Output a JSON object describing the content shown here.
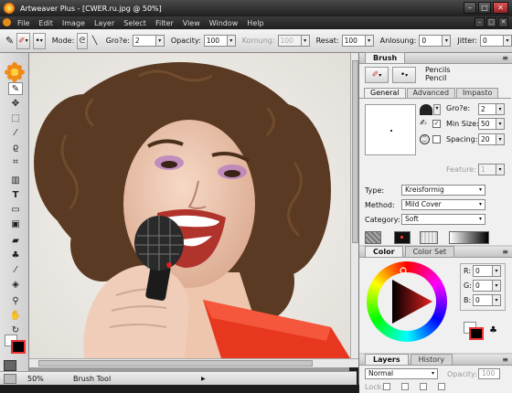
{
  "window": {
    "title": "Artweaver Plus - [CWER.ru.jpg @ 50%]",
    "minimize": "–",
    "maximize": "□",
    "close": "✕"
  },
  "menu": {
    "items": [
      "File",
      "Edit",
      "Image",
      "Layer",
      "Select",
      "Filter",
      "View",
      "Window",
      "Help"
    ],
    "doc_controls": [
      "–",
      "□",
      "✕"
    ]
  },
  "options": {
    "mode_label": "Mode:",
    "size_label": "Gro?e:",
    "size_value": "2",
    "opacity_label": "Opacity:",
    "opacity_value": "100",
    "kornung_label": "Kornung:",
    "kornung_value": "100",
    "resat_label": "Resat:",
    "resat_value": "100",
    "anlosung_label": "Anlosung:",
    "anlosung_value": "0",
    "jitter_label": "Jitter:",
    "jitter_value": "0"
  },
  "status": {
    "zoom": "50%",
    "tool": "Brush Tool",
    "arrow": "▶"
  },
  "brush_panel": {
    "tab": "Brush",
    "category1": "Pencils",
    "category2": "Pencil",
    "tabs": [
      "General",
      "Advanced",
      "Impasto"
    ],
    "size_label": "Gro?e:",
    "size_value": "2",
    "min_size_label": "Min Size:",
    "min_size_value": "50",
    "spacing_label": "Spacing:",
    "spacing_value": "20",
    "feature_label": "Feature:",
    "feature_value": "1",
    "type_label": "Type:",
    "type_value": "Kreisformig",
    "method_label": "Method:",
    "method_value": "Mild Cover",
    "category_label": "Category:",
    "category_value": "Soft"
  },
  "color_panel": {
    "tabs": [
      "Color",
      "Color Set"
    ],
    "r_label": "R:",
    "r_value": "0",
    "g_label": "G:",
    "g_value": "0",
    "b_label": "B:",
    "b_value": "0"
  },
  "layers_panel": {
    "tabs": [
      "Layers",
      "History"
    ],
    "blend_mode": "Normal",
    "opacity_label": "Opacity:",
    "opacity_value": "100",
    "lock_label": "Lock:"
  },
  "colors": {
    "foreground": "#000000",
    "background": "#ffffff",
    "accent": "#e87d13"
  },
  "icons": {
    "tools": [
      "brush-icon",
      "move-icon",
      "rect-select-icon",
      "magic-wand-icon",
      "lasso-icon",
      "crop-icon",
      "stamp-icon",
      "text-icon",
      "rectangle-icon",
      "gradient-icon",
      "eraser-icon",
      "clone-icon",
      "eyedropper-icon",
      "fill-icon",
      "zoom-icon",
      "hand-icon",
      "rotate-icon"
    ]
  }
}
